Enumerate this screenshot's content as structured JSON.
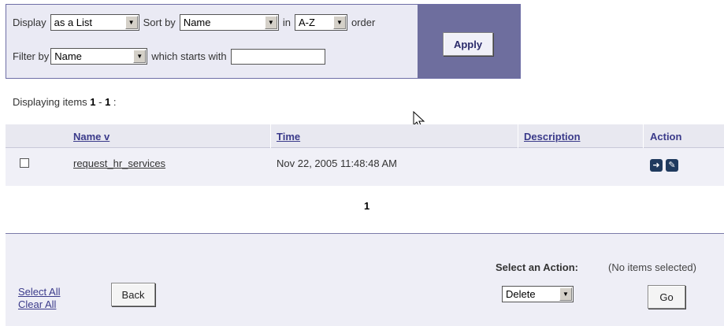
{
  "filter": {
    "display_label": "Display",
    "display_value": "as a List",
    "sort_label": "Sort by",
    "sort_value": "Name",
    "in_label": "in",
    "order_value": "A-Z",
    "order_label": "order",
    "filter_label": "Filter by",
    "filter_value": "Name",
    "starts_with_label": "which starts with",
    "starts_with_value": "",
    "apply_label": "Apply"
  },
  "summary": {
    "prefix": "Displaying items ",
    "from": "1",
    "dash": " - ",
    "to": "1",
    "suffix": " :"
  },
  "table": {
    "columns": {
      "name": "Name v",
      "time": "Time",
      "description": "Description",
      "action": "Action"
    },
    "rows": [
      {
        "name": "request_hr_services",
        "time": "Nov 22, 2005 11:48:48 AM",
        "description": "",
        "actions": [
          "open-icon",
          "edit-icon"
        ]
      }
    ]
  },
  "pagination": {
    "current": "1"
  },
  "footer": {
    "select_all": "Select All",
    "clear_all": "Clear All",
    "back_label": "Back",
    "select_action_label": "Select an Action:",
    "selection_status": "(No items selected)",
    "action_value": "Delete",
    "go_label": "Go"
  }
}
